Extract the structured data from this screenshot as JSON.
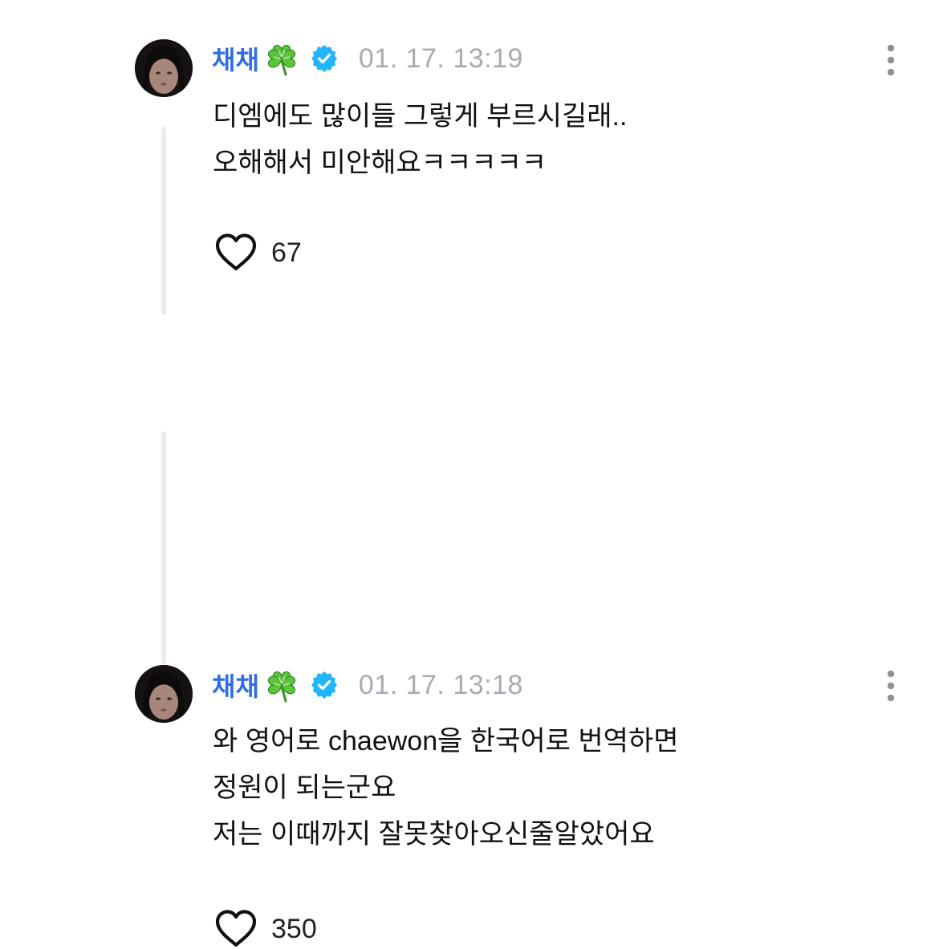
{
  "colors": {
    "username": "#2f6de1",
    "timestamp": "#a9abb3",
    "verified_badge": "#22b5ff",
    "thread_line": "#ebebef",
    "body_text": "#111111"
  },
  "comments": [
    {
      "username": "채채",
      "username_emoji": "four-leaf-clover-icon",
      "verified": true,
      "timestamp": "01. 17. 13:19",
      "lines": [
        "디엠에도 많이들 그렇게 부르시길래..",
        "오해해서 미안해요ㅋㅋㅋㅋㅋ"
      ],
      "likes": "67"
    },
    {
      "username": "채채",
      "username_emoji": "four-leaf-clover-icon",
      "verified": true,
      "timestamp": "01. 17. 13:18",
      "lines": [
        "와 영어로 chaewon을 한국어로 번역하면",
        "정원이 되는군요",
        "저는 이때까지 잘못찾아오신줄알았어요"
      ],
      "likes": "350"
    }
  ]
}
